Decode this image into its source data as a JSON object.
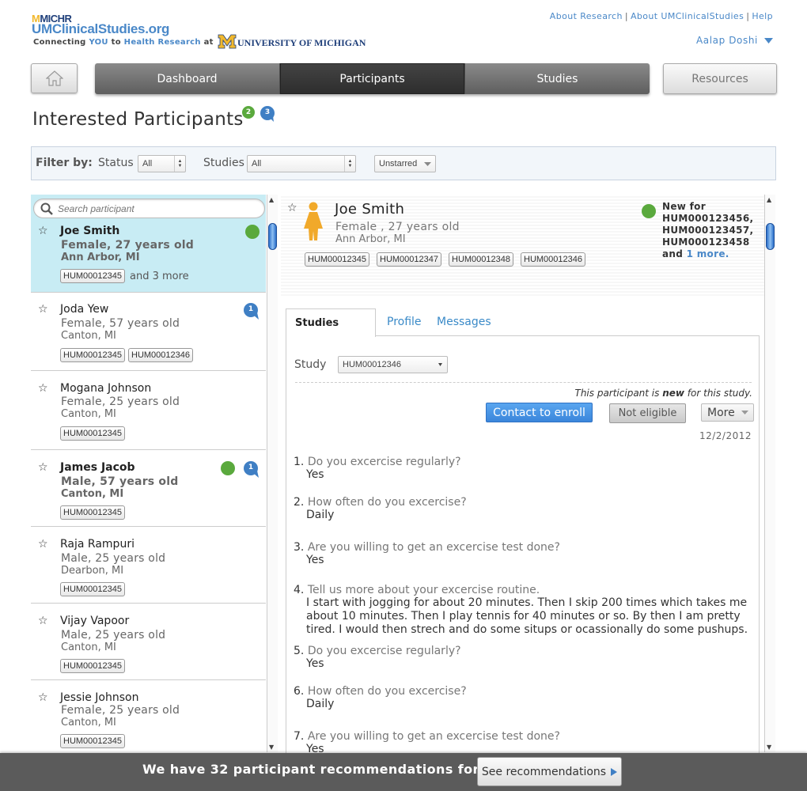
{
  "header": {
    "logo_michr": "MICHR",
    "logo_site": "UMClinicalStudies.org",
    "tagline_parts": [
      "Connecting ",
      "YOU",
      " to ",
      "Health Research",
      " at"
    ],
    "um_logo": "UNIVERSITY OF MICHIGAN",
    "top_links": [
      "About Research",
      "About UMClinicalStudies",
      "Help"
    ],
    "user_name": "Aalap Doshi"
  },
  "nav": {
    "tabs": [
      "Dashboard",
      "Participants",
      "Studies"
    ],
    "active_tab": "Participants",
    "resources": "Resources"
  },
  "page": {
    "title": "Interested Participants",
    "badge_new": "2",
    "badge_messages": "3"
  },
  "filter": {
    "label": "Filter by:",
    "status_label": "Status",
    "status_value": "All",
    "studies_label": "Studies",
    "studies_value": "All",
    "starred_value": "Unstarred"
  },
  "search": {
    "placeholder": "Search participant"
  },
  "participants": [
    {
      "name": "Joe Smith",
      "desc": "Female, 27 years old",
      "location": "Ann Arbor, MI",
      "tags": [
        "HUM00012345"
      ],
      "more": "and 3 more"
    },
    {
      "name": "Joda Yew",
      "desc": "Female, 57 years old",
      "location": "Canton, MI",
      "tags": [
        "HUM00012345",
        "HUM00012346"
      ],
      "messages": "1"
    },
    {
      "name": "Mogana Johnson",
      "desc": "Female, 25 years old",
      "location": "Canton, MI",
      "tags": [
        "HUM00012345"
      ]
    },
    {
      "name": "James Jacob",
      "desc": "Male, 57 years old",
      "location": "Canton, MI",
      "tags": [
        "HUM00012345"
      ],
      "messages": "1"
    },
    {
      "name": "Raja Rampuri",
      "desc": "Male, 25 years old",
      "location": "Dearbon, MI",
      "tags": [
        "HUM00012345"
      ]
    },
    {
      "name": "Vijay Vapoor",
      "desc": "Male, 25 years old",
      "location": "Canton, MI",
      "tags": [
        "HUM00012345"
      ]
    },
    {
      "name": "Jessie Johnson",
      "desc": "Female, 25 years old",
      "location": "Canton, MI",
      "tags": [
        "HUM00012345"
      ]
    }
  ],
  "detail": {
    "name": "Joe Smith",
    "desc": "Female , 27 years old",
    "location": "Ann Arbor, MI",
    "tags": [
      "HUM00012345",
      "HUM00012347",
      "HUM00012348",
      "HUM00012346"
    ],
    "new_for_label": "New for",
    "new_for_ids": [
      "HUM000123456,",
      "HUM000123457,",
      "HUM000123458"
    ],
    "new_for_and": "and",
    "new_for_more": "1 more.",
    "tabs": [
      "Studies",
      "Profile",
      "Messages"
    ],
    "study_label": "Study",
    "study_value": "HUM00012346",
    "note_prefix": "This participant is ",
    "note_bold": "new",
    "note_suffix": " for this study.",
    "contact_button": "Contact to enroll",
    "not_eligible_button": "Not eligible",
    "more_button": "More",
    "date": "12/2/2012",
    "questions": [
      {
        "n": "1.",
        "q": "Do you excercise regularly?",
        "a": "Yes"
      },
      {
        "n": "2.",
        "q": "How often do you excercise?",
        "a": "Daily"
      },
      {
        "n": "3.",
        "q": "Are you willing to get an excercise test done?",
        "a": "Yes"
      },
      {
        "n": "4.",
        "q": "Tell us more about your excercise routine.",
        "a": "I start with jogging for about 20 minutes. Then I skip 200 times which takes me about 10 minutes. Then I play tennis for 40 minutes or so. By then I am pretty tired. I would then strech and do some situps or ocassionally do some pushups."
      },
      {
        "n": "5.",
        "q": "Do you excercise regularly?",
        "a": "Yes"
      },
      {
        "n": "6.",
        "q": "How often do you excercise?",
        "a": "Daily"
      },
      {
        "n": "7.",
        "q": "Are you willing to get an excercise test done?",
        "a": "Yes"
      }
    ]
  },
  "bottom": {
    "text": "We have 32 participant recommendations for you",
    "button": "See recommendations"
  },
  "colors": {
    "accent": "#4a88c8",
    "green": "#5aa93d",
    "selected": "#c8ecf4",
    "primary_button": "#3b86db"
  }
}
